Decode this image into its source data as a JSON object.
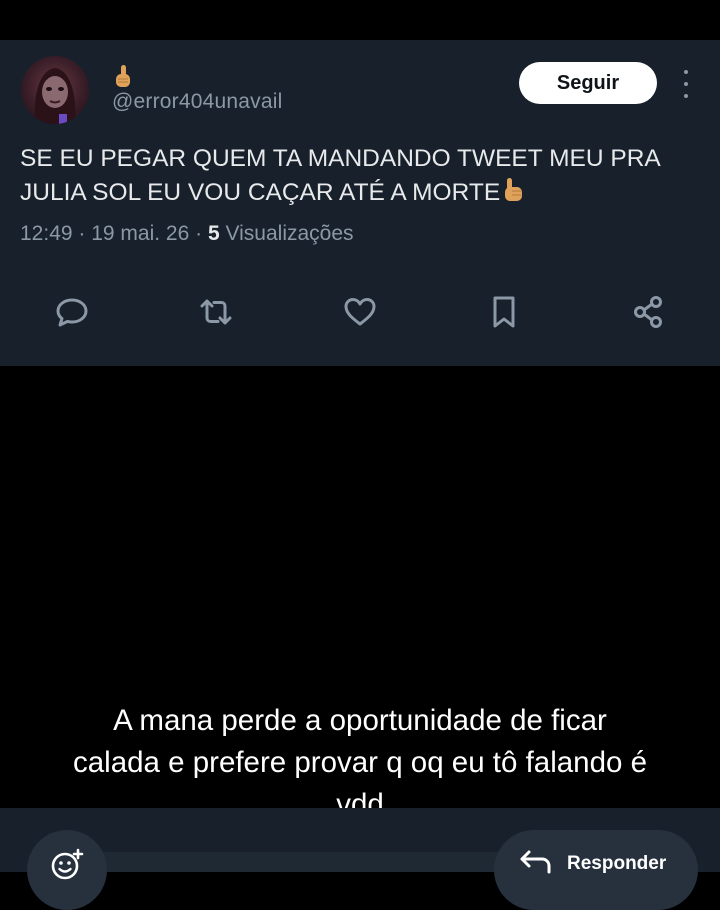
{
  "tweet": {
    "handle": "@error404unavail",
    "follow_label": "Seguir",
    "text_lines": [
      "SE EU PEGAR QUEM TA MANDANDO TWEET MEU PRA",
      "JULIA SOL EU VOU CAÇAR ATÉ A MORTE"
    ],
    "time": "12:49",
    "date": "19 mai. 26",
    "views_count": "5",
    "views_label": "Visualizações",
    "actions": [
      "reply-icon",
      "retweet-icon",
      "like-icon",
      "bookmark-icon",
      "share-icon"
    ]
  },
  "caption": {
    "lines": [
      "A mana perde a oportunidade de ficar",
      "calada e prefere provar q oq eu tô falando é",
      "vdd"
    ]
  },
  "bottom_bar": {
    "reply_label": "Responder"
  },
  "colors": {
    "card_bg": "#17202b",
    "secondary_text": "#8b98a5",
    "primary_text": "#e7e9ea"
  }
}
